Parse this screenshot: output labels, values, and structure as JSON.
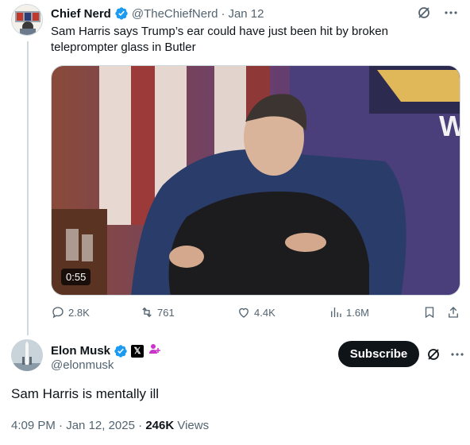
{
  "quoted_tweet": {
    "display_name": "Chief Nerd",
    "handle": "@TheChiefNerd",
    "separator": "·",
    "date": "Jan 12",
    "text": "Sam Harris says Trump’s ear could have just been hit by broken teleprompter glass in Butler",
    "video_duration": "0:55",
    "stats": {
      "replies": "2.8K",
      "reposts": "761",
      "likes": "4.4K",
      "views": "1.6M"
    }
  },
  "main_tweet": {
    "display_name": "Elon Musk",
    "handle": "@elonmusk",
    "subscribe_label": "Subscribe",
    "text": "Sam Harris is mentally ill",
    "time": "4:09 PM",
    "separator": "·",
    "date": "Jan 12, 2025",
    "views_count": "246K",
    "views_label": "Views"
  },
  "colors": {
    "verified": "#1d9bf0",
    "text_primary": "#0f1419",
    "text_muted": "#536471",
    "border": "#cfd9de",
    "affiliate_badge": "#c936c9"
  },
  "icons": [
    "verified-badge-icon",
    "grok-icon",
    "more-icon",
    "reply-icon",
    "repost-icon",
    "like-icon",
    "views-icon",
    "bookmark-icon",
    "share-icon",
    "x-affiliate-icon",
    "gender-badge-icon"
  ]
}
